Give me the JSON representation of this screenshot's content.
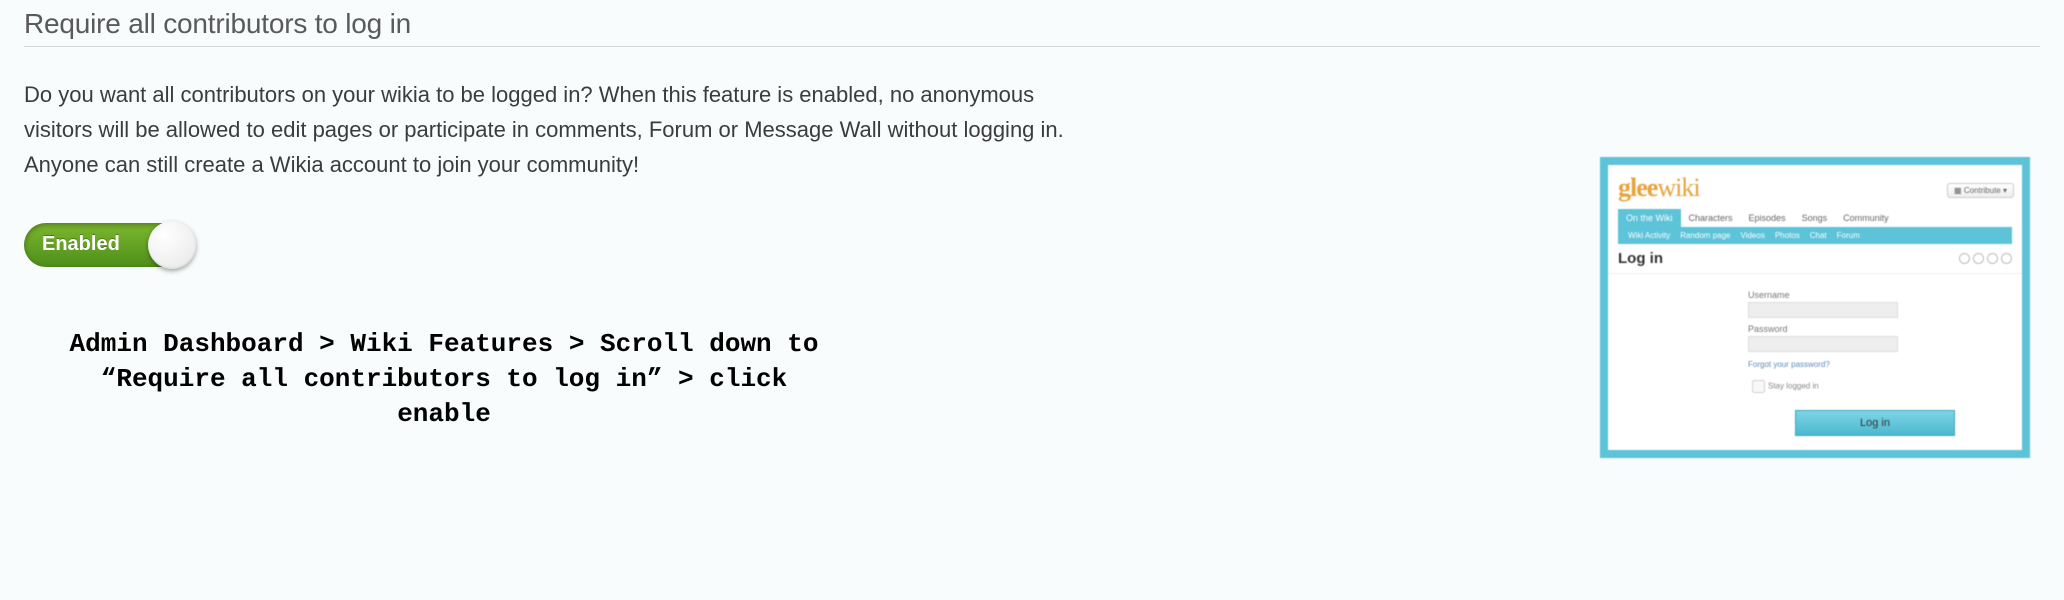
{
  "section": {
    "title": "Require all contributors to log in",
    "description": "Do you want all contributors on your wikia to be logged in? When this feature is enabled, no anonymous visitors will be allowed to edit pages or participate in comments, Forum or Message Wall without logging in. Anyone can still create a Wikia account to join your community!"
  },
  "toggle": {
    "label": "Enabled"
  },
  "instructions": "Admin Dashboard > Wiki Features > Scroll down to\n“Require all contributors to log in” > click enable",
  "preview": {
    "logo_bold": "glee",
    "logo_thin": "wiki",
    "contribute": "Contribute",
    "tabs": [
      "On the Wiki",
      "Characters",
      "Episodes",
      "Songs",
      "Community"
    ],
    "subtabs": [
      "Wiki Activity",
      "Random page",
      "Videos",
      "Photos",
      "Chat",
      "Forum"
    ],
    "login_title": "Log in",
    "username_label": "Username",
    "password_label": "Password",
    "forgot": "Forgot your password?",
    "stay": "Stay logged in",
    "login_button": "Log in"
  }
}
